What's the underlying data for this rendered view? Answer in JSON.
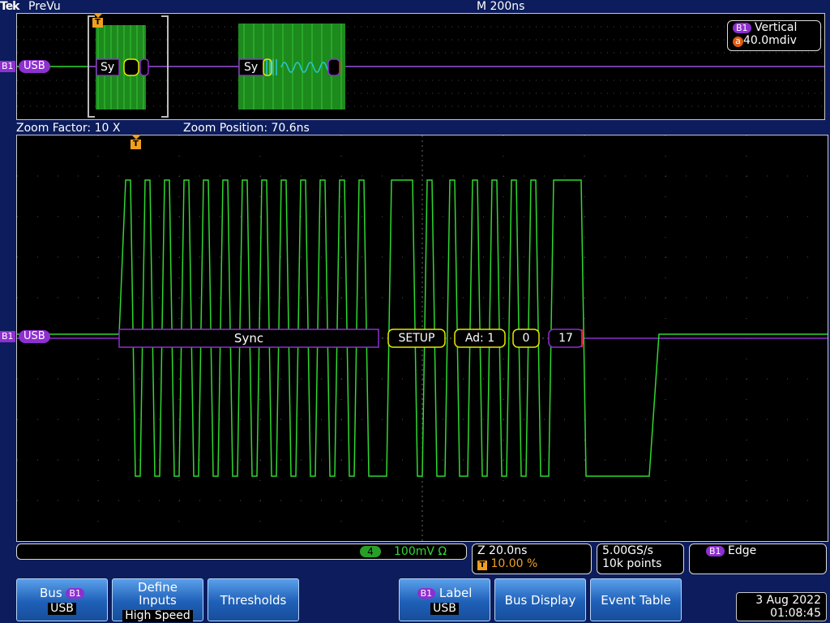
{
  "header": {
    "brand": "Tek",
    "mode": "PreVu",
    "timebase": "M 200ns"
  },
  "overview": {
    "bus_marker": "B1",
    "bus_label": "USB",
    "packet1_sync": "Sy",
    "packet2_sync": "Sy",
    "trigger_marker": "T",
    "vertical_badge": "B1",
    "vertical_title": "Vertical",
    "vertical_icon": "a",
    "vertical_value": "40.0mdiv"
  },
  "zoom": {
    "factor": "Zoom Factor: 10 X",
    "position": "Zoom Position: 70.6ns"
  },
  "main": {
    "trigger_marker": "T",
    "bus_marker": "B1",
    "bus_label": "USB",
    "decode": {
      "sync": "Sync",
      "setup": "SETUP",
      "address": "Ad: 1",
      "endpoint": "0",
      "crc": "17"
    }
  },
  "status": {
    "channel_num": "4",
    "channel_value": "100mV Ω",
    "zoom_scale": "Z 20.0ns",
    "trigger_icon": "T",
    "trigger_pos": "10.00 %",
    "sample_rate": "5.00GS/s",
    "record_length": "10k points",
    "trigger_badge": "B1",
    "trigger_type": "Edge"
  },
  "buttons": {
    "bus": {
      "label": "Bus",
      "badge": "B1",
      "value": "USB"
    },
    "define_inputs": {
      "line1": "Define",
      "line2": "Inputs",
      "value": "High Speed"
    },
    "thresholds": {
      "label": "Thresholds"
    },
    "label": {
      "badge": "B1",
      "label": "Label",
      "value": "USB"
    },
    "bus_display": {
      "label": "Bus Display"
    },
    "event_table": {
      "label": "Event Table"
    }
  },
  "datetime": {
    "date": "3 Aug 2022",
    "time": "01:08:45"
  },
  "colors": {
    "waveform": "#2fd82f",
    "bus": "#8e2fd0",
    "setup": "#e8e800",
    "trigger": "#f0a020",
    "button": "#2a6fc8"
  }
}
